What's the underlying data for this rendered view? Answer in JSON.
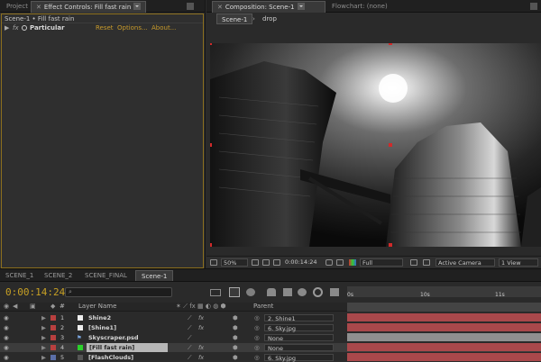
{
  "left_tabs": {
    "project": "Project",
    "effect_controls": "Effect Controls: Fill fast rain"
  },
  "breadcrumb": "Scene-1 • Fill fast rain",
  "effect": {
    "name": "Particular",
    "fx": "fx",
    "reset": "Reset",
    "options": "Options...",
    "about": "About..."
  },
  "comp_tabs": {
    "composition": "Composition: Scene-1",
    "flowchart": "Flowchart: (none)"
  },
  "comp_nav": {
    "current": "Scene-1",
    "separator": "›",
    "next": "drop"
  },
  "viewer_bar": {
    "zoom": "50%",
    "time": "0:00:14:24",
    "resolution": "Full",
    "camera": "Active Camera",
    "views": "1 View"
  },
  "timeline": {
    "tabs": [
      "SCENE_1",
      "SCENE_2",
      "SCENE_FINAL",
      "Scene-1"
    ],
    "timecode": "0:00:14:24",
    "col_hash": "#",
    "col_layer_name": "Layer Name",
    "col_parent": "Parent",
    "ruler": {
      "t0": "0s",
      "t1": "10s",
      "t2": "11s"
    },
    "layers": [
      {
        "num": "1",
        "name": "Shine2",
        "label_color": "#b8403f",
        "icon": "solid",
        "parent": "2. Shine1"
      },
      {
        "num": "2",
        "name": "[Shine1]",
        "label_color": "#b8403f",
        "icon": "solid",
        "parent": "6. Sky.jpg"
      },
      {
        "num": "3",
        "name": "Skyscraper.psd",
        "label_color": "#b8403f",
        "icon": "psd",
        "parent": "None"
      },
      {
        "num": "4",
        "name": "[Fill fast rain]",
        "label_color": "#b8403f",
        "icon": "solid-green",
        "parent": "None"
      },
      {
        "num": "5",
        "name": "[FlashClouds]",
        "label_color": "#5b6fa8",
        "icon": "solid-dark",
        "parent": "6. Sky.jpg"
      }
    ]
  },
  "colors": {
    "accent_orange": "#c79a2b",
    "panel_border_active": "#8c6f1d",
    "layer_red": "#b8403f",
    "layer_bar": "#a9484b",
    "timecode": "#c7a024"
  }
}
